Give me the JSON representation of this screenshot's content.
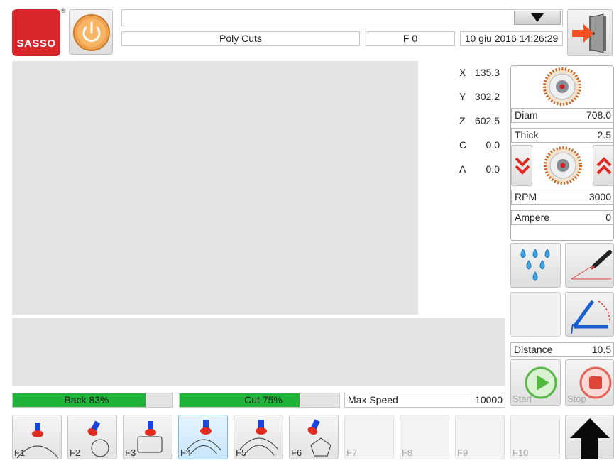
{
  "brand": {
    "logo_text": "SASSO",
    "registered_mark": "®"
  },
  "header": {
    "program_name": "Poly Cuts",
    "feed_label": "F 0",
    "datetime": "10 giu 2016 14:26:29"
  },
  "axes": [
    {
      "label": "X",
      "value": "135.3"
    },
    {
      "label": "Y",
      "value": "302.2"
    },
    {
      "label": "Z",
      "value": "602.5"
    },
    {
      "label": "C",
      "value": "0.0"
    },
    {
      "label": "A",
      "value": "0.0"
    }
  ],
  "blade": {
    "diam_label": "Diam",
    "diam_value": "708.0",
    "thick_label": "Thick",
    "thick_value": "2.5",
    "rpm_label": "RPM",
    "rpm_value": "3000",
    "ampere_label": "Ampere",
    "ampere_value": "0"
  },
  "distance": {
    "label": "Distance",
    "value": "10.5"
  },
  "progress": {
    "back": {
      "label": "Back 83%",
      "percent": 83
    },
    "cut": {
      "label": "Cut 75%",
      "percent": 75
    }
  },
  "max_speed": {
    "label": "Max Speed",
    "value": "10000"
  },
  "controls": {
    "start_label": "Start",
    "stop_label": "Stop"
  },
  "function_keys": [
    "F1",
    "F2",
    "F3",
    "F4",
    "F5",
    "F6",
    "F7",
    "F8",
    "F9",
    "F10"
  ],
  "colors": {
    "progress_green": "#1fb33a",
    "accent_red": "#e03a2f",
    "active_key": "#c7e5fb"
  }
}
